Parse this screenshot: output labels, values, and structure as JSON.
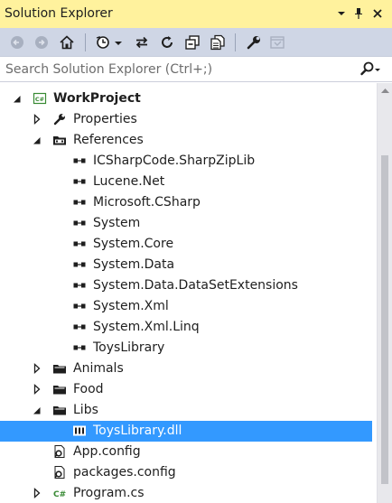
{
  "panel": {
    "title": "Solution Explorer",
    "title_menu_icon": "dropdown-arrow-icon",
    "pin_icon": "pin-icon",
    "close_icon": "close-icon"
  },
  "toolbar": {
    "buttons": [
      {
        "name": "back-button",
        "icon": "back-arrow-icon"
      },
      {
        "name": "forward-button",
        "icon": "forward-arrow-icon"
      },
      {
        "name": "home-button",
        "icon": "home-icon"
      },
      {
        "name": "pending-changes-filter-button",
        "icon": "clock-icon"
      },
      {
        "name": "sync-active-document-button",
        "icon": "sync-arrows-icon"
      },
      {
        "name": "refresh-button",
        "icon": "refresh-icon"
      },
      {
        "name": "collapse-all-button",
        "icon": "collapse-all-icon"
      },
      {
        "name": "show-all-files-button",
        "icon": "show-all-files-icon"
      },
      {
        "name": "properties-button",
        "icon": "wrench-icon"
      },
      {
        "name": "preview-selected-items-button",
        "icon": "preview-icon"
      }
    ]
  },
  "search": {
    "placeholder": "Search Solution Explorer (Ctrl+;)",
    "value": ""
  },
  "tree": {
    "items": [
      {
        "label": "WorkProject",
        "level": 0,
        "expander": "expanded",
        "icon": "csharp-project-icon",
        "bold": true
      },
      {
        "label": "Properties",
        "level": 1,
        "expander": "collapsed",
        "icon": "wrench-icon"
      },
      {
        "label": "References",
        "level": 1,
        "expander": "expanded",
        "icon": "references-folder-icon"
      },
      {
        "label": "ICSharpCode.SharpZipLib",
        "level": 2,
        "expander": "none",
        "icon": "reference-icon"
      },
      {
        "label": "Lucene.Net",
        "level": 2,
        "expander": "none",
        "icon": "reference-icon"
      },
      {
        "label": "Microsoft.CSharp",
        "level": 2,
        "expander": "none",
        "icon": "reference-icon"
      },
      {
        "label": "System",
        "level": 2,
        "expander": "none",
        "icon": "reference-icon"
      },
      {
        "label": "System.Core",
        "level": 2,
        "expander": "none",
        "icon": "reference-icon"
      },
      {
        "label": "System.Data",
        "level": 2,
        "expander": "none",
        "icon": "reference-icon"
      },
      {
        "label": "System.Data.DataSetExtensions",
        "level": 2,
        "expander": "none",
        "icon": "reference-icon"
      },
      {
        "label": "System.Xml",
        "level": 2,
        "expander": "none",
        "icon": "reference-icon"
      },
      {
        "label": "System.Xml.Linq",
        "level": 2,
        "expander": "none",
        "icon": "reference-icon"
      },
      {
        "label": "ToysLibrary",
        "level": 2,
        "expander": "none",
        "icon": "reference-icon"
      },
      {
        "label": "Animals",
        "level": 1,
        "expander": "collapsed",
        "icon": "folder-icon"
      },
      {
        "label": "Food",
        "level": 1,
        "expander": "collapsed",
        "icon": "folder-icon"
      },
      {
        "label": "Libs",
        "level": 1,
        "expander": "expanded",
        "icon": "folder-icon"
      },
      {
        "label": "ToysLibrary.dll",
        "level": 2,
        "expander": "none",
        "icon": "dll-file-icon",
        "selected": true
      },
      {
        "label": "App.config",
        "level": 1,
        "expander": "none",
        "icon": "config-file-icon"
      },
      {
        "label": "packages.config",
        "level": 1,
        "expander": "none",
        "icon": "config-file-icon"
      },
      {
        "label": "Program.cs",
        "level": 1,
        "expander": "collapsed",
        "icon": "csharp-file-icon"
      }
    ]
  },
  "colors": {
    "title_bar": "#fff29d",
    "toolbar": "#cfd6e5",
    "selection": "#3399ff",
    "scrollbar_thumb": "#c2c3c9"
  }
}
